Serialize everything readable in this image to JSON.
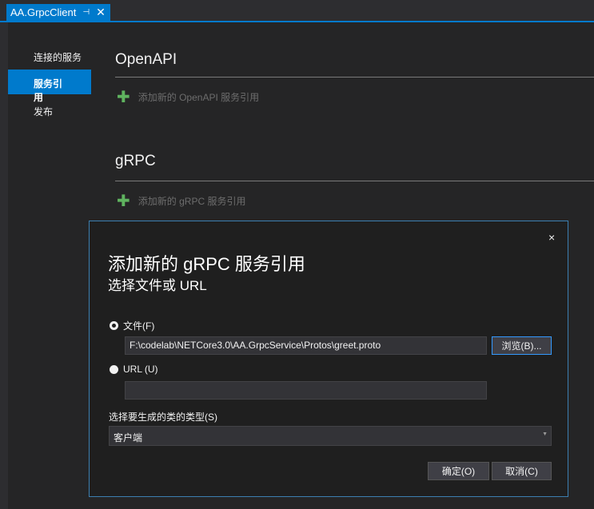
{
  "tab": {
    "title": "AA.GrpcClient",
    "pin_icon": "pin-icon",
    "close_icon": "close-icon"
  },
  "sidebar": {
    "items": [
      {
        "label": "连接的服务"
      },
      {
        "label": "服务引用"
      },
      {
        "label": "发布"
      }
    ]
  },
  "sections": [
    {
      "title": "OpenAPI",
      "add_label": "添加新的 OpenAPI 服务引用"
    },
    {
      "title": "gRPC",
      "add_label": "添加新的 gRPC 服务引用"
    }
  ],
  "dialog": {
    "title": "添加新的 gRPC 服务引用",
    "subtitle": "选择文件或 URL",
    "close": "×",
    "file_radio": "文件(F)",
    "file_value": "F:\\codelab\\NETCore3.0\\AA.GrpcService\\Protos\\greet.proto",
    "browse": "浏览(B)...",
    "url_radio": "URL (U)",
    "url_value": "",
    "class_type_label": "选择要生成的类的类型(S)",
    "class_type_value": "客户端",
    "ok": "确定(O)",
    "cancel": "取消(C)"
  }
}
